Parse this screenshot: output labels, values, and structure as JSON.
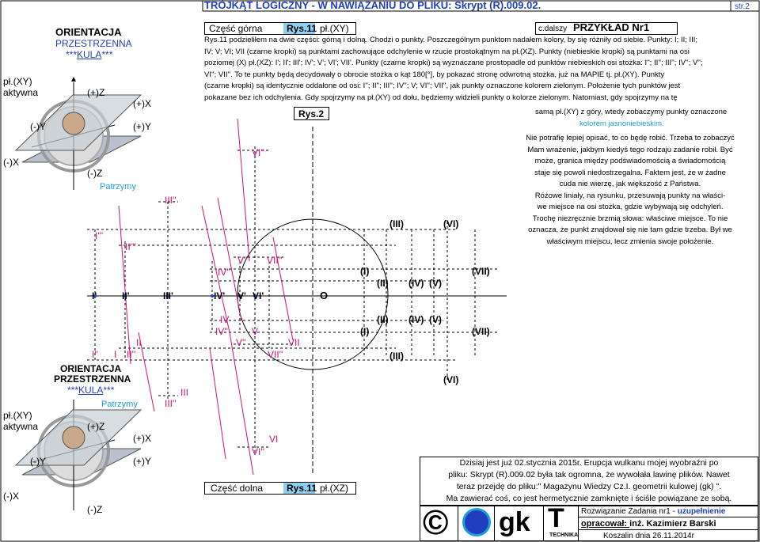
{
  "header": {
    "title": "TRÓJKĄT LOGICZNY -  W NAWIĄZANIU DO PLIKU: Skrypt (R).009.02.",
    "page": "str.2"
  },
  "top_bar": {
    "part": "Część górna",
    "fig": "Rys.11",
    "plane": "pł.(XY)",
    "cont": "c.dalszy",
    "example": "PRZYKŁAD Nr1"
  },
  "left_top": {
    "l1": "ORIENTACJA",
    "l2": "PRZESTRZENNA",
    "l3_pre": "***",
    "l3_kula": "KULA",
    "l3_post": "***",
    "plane": "pł.(XY)",
    "active": "aktywna",
    "pz": "(+)Z",
    "px": "(+)X",
    "my": "(-)Y",
    "py": "(+)Y",
    "mx": "(-)X",
    "mz": "(-)Z",
    "hold": "Patrzymy"
  },
  "left_bottom": {
    "l1": "ORIENTACJA",
    "l2": "PRZESTRZENNA",
    "l3_pre": "***",
    "l3_kula": "KULA",
    "l3_post": "***",
    "hold": "Patrzymy",
    "plane": "pł.(XY)",
    "active": "aktywna",
    "pz": "(+)Z",
    "px": "(+)X",
    "my": "(-)Y",
    "py": "(+)Y",
    "mx": "(-)X",
    "mz": "(-)Z"
  },
  "text_top": {
    "line1": "Rys.11 podzieliłem na dwie części: górną i dolną. Chodzi o punkty. Poszczególnym punktom nadałem kolory, by się różniły od siebie. Punkty: I; II; III;",
    "line2": "IV; V; VI; VII (czarne kropki) są punktami zachowujące odchylenie w rzucie prostokątnym na pł.(XZ). Punkty (niebieskie kropki) są punktami na osi",
    "line3": "poziomej (X) pł.(XZ): I'; II'; III'; IV'; V'; VI'; VII'. Punkty (czarne kropki) są wyznaczane prostopadle od punktów niebieskich osi stożka: I''; II''; III''; IV''; V'';",
    "line4": "VI''; VII''. To te punkty będą decydowały o obrocie stożka o kąt 180[°], by pokazać stronę odwrotną stożka, już na MAPIE tj. pł.(XY). Punkty",
    "line5": "(czarne kropki) są identycznie oddalone od osi: I''; II''; III''; IV''; V; VI''; VII'', jak punkty oznaczone kolorem zielonym. Położenie tych punktów jest",
    "line6": "pokazane bez ich odchylenia. Gdy spojrzymy na pł.(XY) od dołu, będziemy widzieli punkty o kolorze zielonym. Natomiast, gdy spojrzymy na tę",
    "fig2": "Rys.2",
    "line7": "samą pł.(XY) z góry, wtedy zobaczymy punkty oznaczone",
    "line8": "kolorem jasnoniebieskim."
  },
  "text_right": {
    "lines": [
      "Nie potrafię lepiej opisać, to co będę robić. Trzeba to zobaczyć",
      "Mam wrażenie, jakbym kiedyś tego rodzaju zadanie robił. Być",
      "może, granica między podświadomością a świadomością",
      "staje się powoli niedostrzegalna. Faktem jest, że w żadne",
      "cuda nie wierzę, jak większość z Państwa.",
      "Różowe liniały, na rysunku, przesuwają punkty na właści-",
      "we miejsce na osi stożka, gdzie wybywają się odchyleń.",
      "Trochę niezręcznie brzmią słowa: właściwe miejsce. To nie",
      "oznacza, że punkt znajdował się nie tam gdzie trzeba. Był we",
      "właściwym miejscu, lecz zmienia swoje położenie."
    ]
  },
  "diagram": {
    "origin": "O",
    "axis_labels": [
      "I'",
      "II'",
      "III'",
      "IV'",
      "V'",
      "VI'"
    ],
    "upper_labels": [
      "VI''",
      "III''",
      "I'''",
      "II'''",
      "V''",
      "VII''",
      "IV''"
    ],
    "roman_upper": [
      "(III)",
      "(VI)",
      "(I)",
      "(VII)",
      "(II)",
      "(IV)",
      "(V)"
    ],
    "roman_lower": [
      "(I)",
      "(II)",
      "(IV)",
      "(V)",
      "(VII)",
      "(III)",
      "(VI)"
    ],
    "lower_labels": [
      "IV",
      "IV''",
      "V",
      "V''",
      "VII",
      "VII''",
      "II",
      "II''",
      "I''",
      "I",
      "III",
      "III''",
      "VI",
      "VI''"
    ]
  },
  "bottom_bar": {
    "part": "Część dolna",
    "fig": "Rys.11",
    "plane": "pł.(XZ)"
  },
  "footer_note": {
    "l1": "Dzisiaj jest już 02.stycznia 2015r. Erupcja wulkanu mojej wyobraźni po",
    "l2": "pliku: Skrypt (R).009.02 była tak ogromna, że wywołała lawinę plików. Nawet",
    "l3": "teraz przejdę do pliku:\" Magazynu Wiedzy Cz.I. geometrii kulowej (gk) \".",
    "l4": "Ma zawierać coś, co jest hermetycznie zamknięte i ściśle powiązane ze sobą."
  },
  "footer_logos": {
    "copyright": "©",
    "gk": "gk",
    "t": "T",
    "technika": "TECHNIKA"
  },
  "footer_info": {
    "task_pre": "Rozwiązanie Zadania nr1 - ",
    "task_post": "uzupełnienie",
    "author_pre": "opracował: ",
    "author": "inż. Kazimierz Barski",
    "place": "Koszalin dnia 26.11.2014r"
  },
  "colors": {
    "blue": "#1f3fbf",
    "light_blue": "#1f9ed9",
    "pink": "#d0107a",
    "green": "#2a9a3a",
    "lines": "#000000"
  }
}
